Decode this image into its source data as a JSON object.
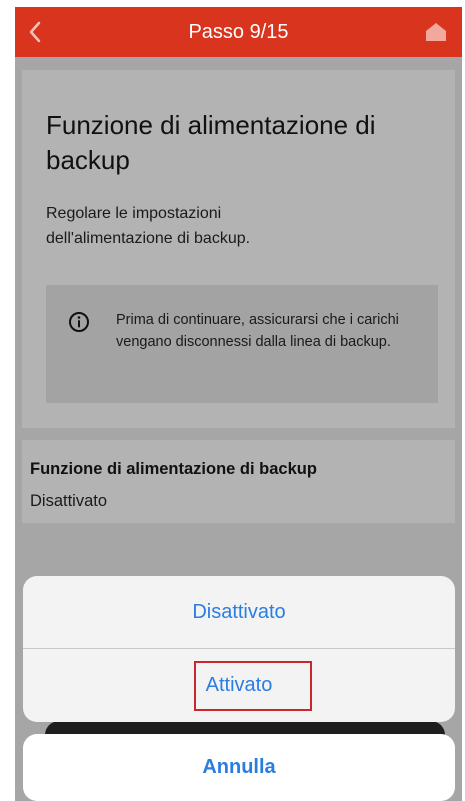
{
  "header": {
    "step_title": "Passo 9/15",
    "back_icon": "chevron-left-icon",
    "home_icon": "home-icon"
  },
  "card": {
    "title": "Funzione di alimentazione di backup",
    "description": "Regolare le impostazioni dell'alimentazione di backup.",
    "notice": {
      "icon": "info-icon",
      "text": "Prima di continuare, assicurarsi che i carichi vengano disconnessi dalla linea di backup."
    }
  },
  "setting": {
    "label": "Funzione di alimentazione di backup",
    "value": "Disattivato"
  },
  "action_sheet": {
    "options": [
      {
        "label": "Disattivato"
      },
      {
        "label": "Attivato"
      }
    ],
    "cancel_label": "Annulla"
  },
  "colors": {
    "header": "#d8341e",
    "accent": "#2a7de1",
    "highlight": "#c8272f",
    "overlay": "#a6a6a6"
  }
}
